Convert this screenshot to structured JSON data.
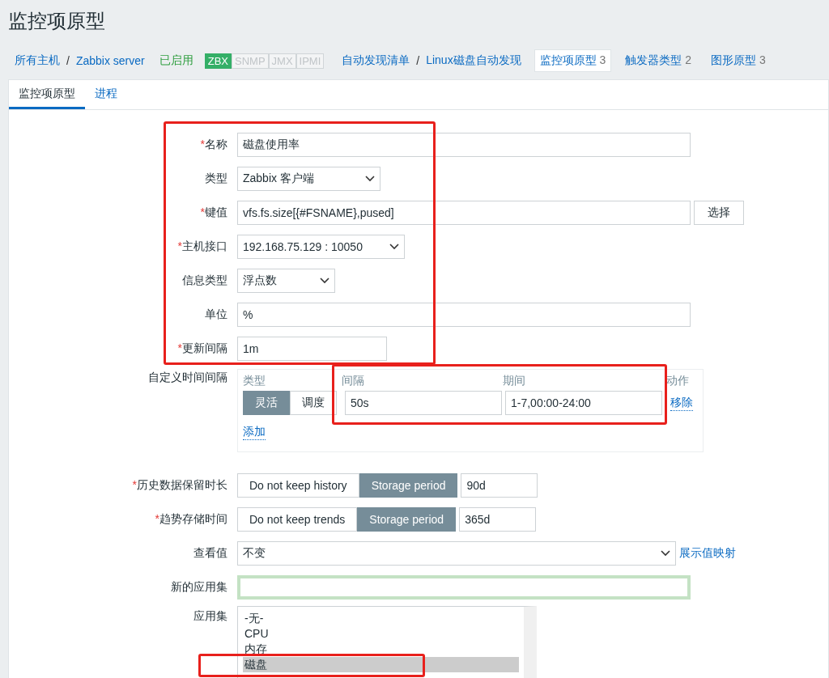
{
  "title": "监控项原型",
  "required_mark": "*",
  "breadcrumb": [
    {
      "kind": "link",
      "label": "所有主机"
    },
    {
      "kind": "sep",
      "label": "/"
    },
    {
      "kind": "link",
      "label": "Zabbix server"
    },
    {
      "kind": "status",
      "label": "已启用"
    },
    {
      "kind": "badges",
      "items": [
        {
          "label": "ZBX",
          "on": true
        },
        {
          "label": "SNMP",
          "on": false
        },
        {
          "label": "JMX",
          "on": false
        },
        {
          "label": "IPMI",
          "on": false
        }
      ]
    },
    {
      "kind": "link",
      "label": "自动发现清单"
    },
    {
      "kind": "sep",
      "label": "/"
    },
    {
      "kind": "link",
      "label": "Linux磁盘自动发现"
    },
    {
      "kind": "nav",
      "label": "监控项原型",
      "count": "3",
      "selected": true
    },
    {
      "kind": "nav",
      "label": "触发器类型",
      "count": "2",
      "selected": false
    },
    {
      "kind": "nav",
      "label": "图形原型",
      "count": "3",
      "selected": false
    }
  ],
  "tabs": [
    {
      "label": "监控项原型",
      "selected": true
    },
    {
      "label": "进程",
      "selected": false
    }
  ],
  "fields": [
    {
      "kind": "text",
      "label": "名称",
      "required": true,
      "value": "磁盘使用率"
    },
    {
      "kind": "select",
      "label": "类型",
      "required": false,
      "value": "Zabbix 客户端"
    },
    {
      "kind": "text-button",
      "label": "键值",
      "required": true,
      "value": "vfs.fs.size[{#FSNAME},pused]",
      "button": "选择"
    },
    {
      "kind": "select",
      "label": "主机接口",
      "required": true,
      "value": "192.168.75.129 : 10050"
    },
    {
      "kind": "select",
      "label": "信息类型",
      "required": false,
      "value": "浮点数"
    },
    {
      "kind": "text",
      "label": "单位",
      "required": false,
      "value": "%"
    },
    {
      "kind": "text",
      "label": "更新间隔",
      "required": true,
      "value": "1m"
    }
  ],
  "custom_intervals": {
    "label": "自定义时间间隔",
    "headers": [
      "类型",
      "间隔",
      "期间",
      "动作"
    ],
    "rows": [
      {
        "type_options": [
          {
            "label": "灵活",
            "selected": true
          },
          {
            "label": "调度",
            "selected": false
          }
        ],
        "interval": "50s",
        "period": "1-7,00:00-24:00",
        "action": "移除"
      }
    ],
    "add": "添加"
  },
  "storage": [
    {
      "label": "历史数据保留时长",
      "required": true,
      "options": [
        {
          "label": "Do not keep history",
          "selected": false
        },
        {
          "label": "Storage period",
          "selected": true
        }
      ],
      "value": "90d"
    },
    {
      "label": "趋势存储时间",
      "required": true,
      "options": [
        {
          "label": "Do not keep trends",
          "selected": false
        },
        {
          "label": "Storage period",
          "selected": true
        }
      ],
      "value": "365d"
    }
  ],
  "show_value": {
    "label": "查看值",
    "value": "不变",
    "link": "展示值映射"
  },
  "new_application": {
    "label": "新的应用集",
    "highlighted": true
  },
  "applications": {
    "label": "应用集",
    "items": [
      {
        "label": "-无-",
        "selected": false
      },
      {
        "label": "CPU",
        "selected": false
      },
      {
        "label": "内存",
        "selected": false
      },
      {
        "label": "磁盘",
        "selected": true
      }
    ]
  }
}
